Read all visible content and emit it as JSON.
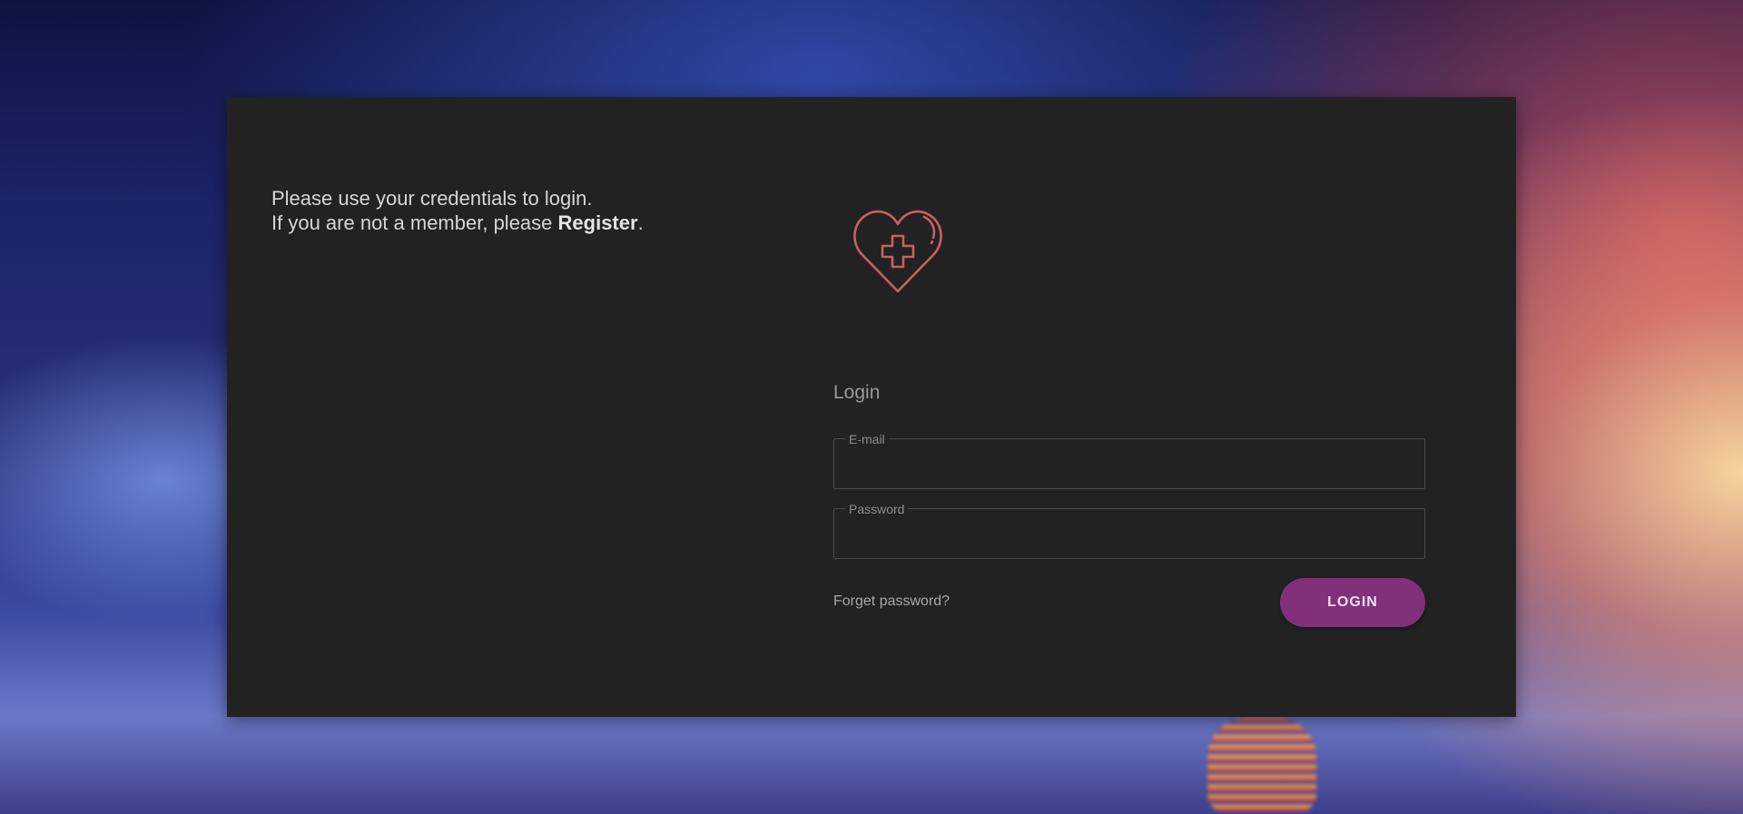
{
  "intro": {
    "line1": "Please use your credentials to login.",
    "line2_prefix": "If you are not a member, please ",
    "register_link": "Register",
    "line2_suffix": "."
  },
  "logo": {
    "icon": "heart-medical-cross-icon",
    "color": "#c9605f"
  },
  "login_form": {
    "title": "Login",
    "email_label": "E-mail",
    "email_value": "",
    "password_label": "Password",
    "password_value": "",
    "forgot_password": "Forget password?",
    "submit_label": "LOGIN"
  },
  "colors": {
    "card_background": "#222222",
    "accent": "#83307b",
    "logo_stroke": "#c9605f"
  }
}
